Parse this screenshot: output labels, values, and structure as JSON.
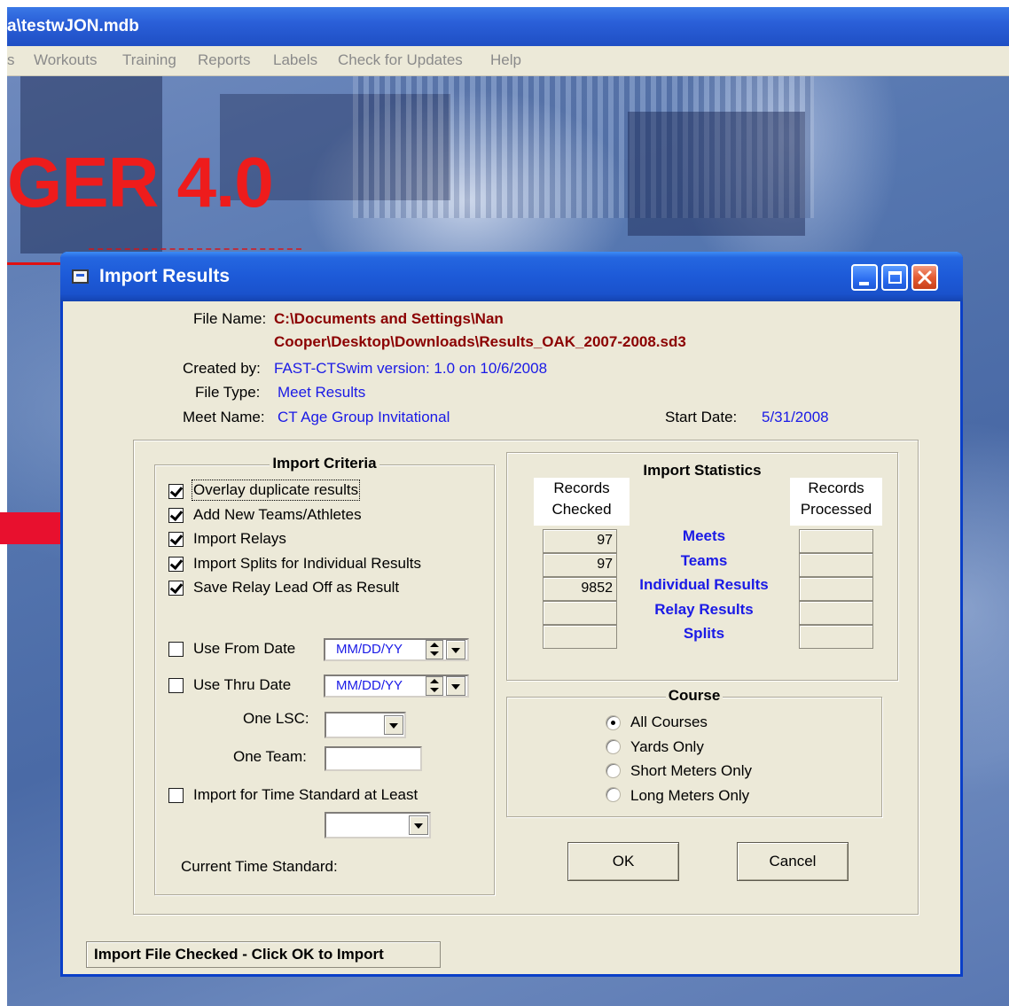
{
  "app": {
    "title": "a\\testwJON.mdb",
    "menu": [
      "s",
      "Workouts",
      "Training",
      "Reports",
      "Labels",
      "Check for Updates",
      "Help"
    ],
    "banner": "GER 4.0"
  },
  "dialog": {
    "title": "Import Results",
    "controls": {
      "minimize": "minimize",
      "maximize": "maximize",
      "close": "close"
    },
    "info": {
      "file_name_label": "File Name:",
      "file_name_line1": "C:\\Documents and Settings\\Nan",
      "file_name_line2": "Cooper\\Desktop\\Downloads\\Results_OAK_2007-2008.sd3",
      "created_by_label": "Created by:",
      "created_by_value": "FAST-CTSwim   version: 1.0 on 10/6/2008",
      "file_type_label": "File Type:",
      "file_type_value": "Meet Results",
      "meet_name_label": "Meet Name:",
      "meet_name_value": "CT Age Group Invitational",
      "start_date_label": "Start Date:",
      "start_date_value": "5/31/2008"
    },
    "import_criteria": {
      "title": "Import Criteria",
      "checkboxes": [
        {
          "label": "Overlay duplicate results",
          "checked": true
        },
        {
          "label": "Add New Teams/Athletes",
          "checked": true
        },
        {
          "label": "Import Relays",
          "checked": true
        },
        {
          "label": "Import Splits for Individual Results",
          "checked": true
        },
        {
          "label": "Save Relay Lead Off as Result",
          "checked": true
        }
      ],
      "use_from_date_label": "Use From Date",
      "use_from_date_value": "MM/DD/YY",
      "use_thru_date_label": "Use Thru Date",
      "use_thru_date_value": "MM/DD/YY",
      "one_lsc_label": "One LSC:",
      "one_team_label": "One Team:",
      "time_standard_label": "Import for Time Standard at Least",
      "current_time_standard_label": "Current Time Standard:"
    },
    "import_statistics": {
      "title": "Import Statistics",
      "records_checked_header": [
        "Records",
        "Checked"
      ],
      "records_processed_header": [
        "Records",
        "Processed"
      ],
      "rows": [
        {
          "label": "Meets",
          "checked": "97",
          "processed": ""
        },
        {
          "label": "Teams",
          "checked": "97",
          "processed": ""
        },
        {
          "label": "Individual Results",
          "checked": "9852",
          "processed": ""
        },
        {
          "label": "Relay Results",
          "checked": "",
          "processed": ""
        },
        {
          "label": "Splits",
          "checked": "",
          "processed": ""
        }
      ]
    },
    "course": {
      "title": "Course",
      "options": [
        {
          "label": "All Courses",
          "selected": true
        },
        {
          "label": "Yards Only",
          "selected": false
        },
        {
          "label": "Short Meters Only",
          "selected": false
        },
        {
          "label": "Long Meters Only",
          "selected": false
        }
      ]
    },
    "ok_label": "OK",
    "cancel_label": "Cancel",
    "status": "Import File Checked - Click OK to Import"
  },
  "colors": {
    "accent_blue": "#1a1ae6",
    "file_red": "#8b0000",
    "banner_red": "#ee1c1c",
    "titlebar_blue": "#1d5ad8"
  }
}
